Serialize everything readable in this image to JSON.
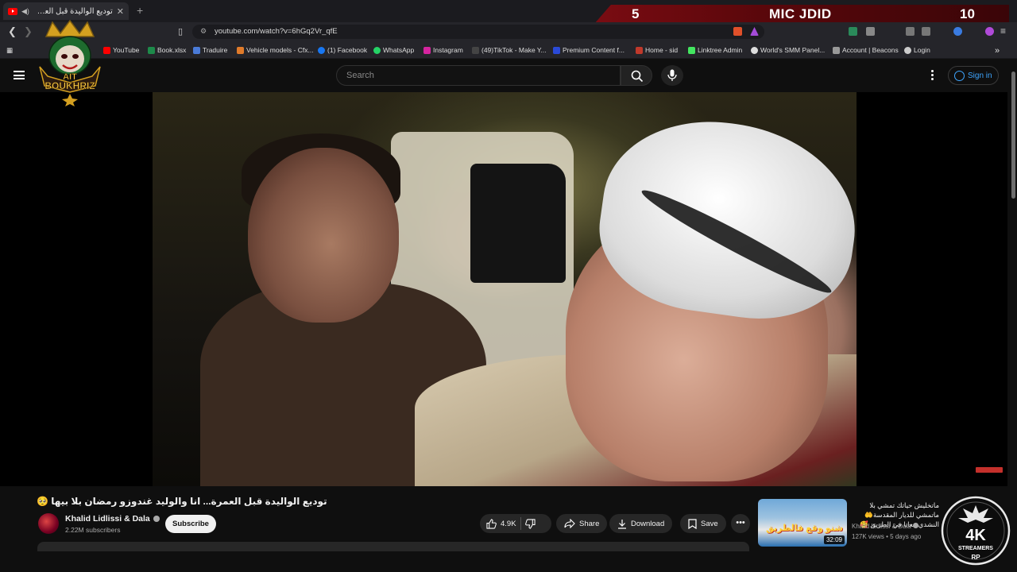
{
  "browser": {
    "tab_title": "توديع الواليدة قبل العمرة... انا و",
    "url": "youtube.com/watch?v=6hGq2Vr_qfE",
    "bookmarks": [
      {
        "label": "YouTube",
        "color": "#ff0000"
      },
      {
        "label": "Book.xlsx",
        "color": "#1d8a4a"
      },
      {
        "label": "Traduire",
        "color": "#4a7bd8"
      },
      {
        "label": "Vehicle models - Cfx...",
        "color": "#e07b2a"
      },
      {
        "label": "(1) Facebook",
        "color": "#1877f2"
      },
      {
        "label": "WhatsApp",
        "color": "#25d366"
      },
      {
        "label": "Instagram",
        "color": "#d6249f"
      },
      {
        "label": "(49)TikTok - Make Y...",
        "color": "#222222"
      },
      {
        "label": "Premium Content f...",
        "color": "#2a4ad8"
      },
      {
        "label": "Home - sid",
        "color": "#c0392b"
      },
      {
        "label": "Linktree Admin",
        "color": "#43e660"
      },
      {
        "label": "World's SMM Panel...",
        "color": "#dddddd"
      },
      {
        "label": "Account | Beacons",
        "color": "#999999"
      },
      {
        "label": "Login",
        "color": "#cccccc"
      }
    ]
  },
  "overlay": {
    "score_left": "5",
    "title": "MIC JDID",
    "score_right": "10",
    "logo_top_line": "AIT",
    "logo_bottom_line": "BOUKHRIZ",
    "badge_main": "4K",
    "badge_sub": "STREAMERS",
    "badge_tag": "RP"
  },
  "youtube": {
    "search_placeholder": "Search",
    "sign_in": "Sign in",
    "video_title": "توديع الواليدة قبل العمرة... انا والوليد غندوزو رمضان بلا بيها 🥺",
    "channel_name": "Khalid Lidlissi & Dala",
    "subscribers": "2.22M subscribers",
    "subscribe_label": "Subscribe",
    "likes": "4.9K",
    "share_label": "Share",
    "download_label": "Download",
    "save_label": "Save",
    "suggested": {
      "title": "ماتخليش حياتك تمشي بلا ماتمشي للديار المقدسة🤲 النشدي معانا في الطريق 🥰",
      "thumb_text": "شنو وقع فالطريق",
      "duration": "32:09",
      "channel": "Khalid Lidlissi & Dala",
      "meta": "127K views • 5 days ago"
    }
  },
  "colors": {
    "accent": "#3ea6ff",
    "youtube_red": "#ff0000",
    "overlay_red": "#7a0c12"
  }
}
